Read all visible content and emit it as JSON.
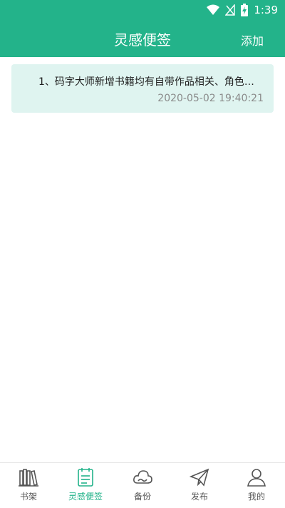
{
  "status": {
    "time": "1:39"
  },
  "header": {
    "title": "灵感便签",
    "add_label": "添加"
  },
  "notes": [
    {
      "text": "1、码字大师新增书籍均有自带作品相关、角色…",
      "time": "2020-05-02 19:40:21"
    }
  ],
  "tabs": [
    {
      "label": "书架",
      "icon": "bookshelf-icon"
    },
    {
      "label": "灵感便签",
      "icon": "notepad-icon",
      "active": true
    },
    {
      "label": "备份",
      "icon": "cloud-icon"
    },
    {
      "label": "发布",
      "icon": "paper-plane-icon"
    },
    {
      "label": "我的",
      "icon": "user-icon"
    }
  ],
  "colors": {
    "accent": "#23b38a",
    "card": "#dff4f0",
    "muted": "#8a8a8a"
  }
}
